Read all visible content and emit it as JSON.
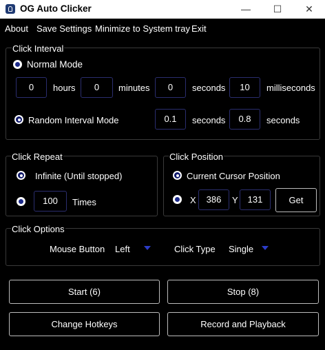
{
  "window": {
    "title": "OG Auto Clicker",
    "minimize": "—",
    "maximize": "☐",
    "close": "✕"
  },
  "menu": [
    "About",
    "Save Settings",
    "Minimize to System tray",
    "Exit"
  ],
  "click_interval": {
    "title": "Click Interval",
    "normal_mode": "Normal Mode",
    "hours_value": "0",
    "hours_label": "hours",
    "minutes_value": "0",
    "minutes_label": "minutes",
    "seconds_value": "0",
    "seconds_label": "seconds",
    "ms_value": "10",
    "ms_label": "milliseconds",
    "random_mode": "Random Interval Mode",
    "random_min": "0.1",
    "random_min_label": "seconds",
    "random_max": "0.8",
    "random_max_label": "seconds"
  },
  "click_repeat": {
    "title": "Click Repeat",
    "infinite": "Infinite (Until stopped)",
    "times_value": "100",
    "times_label": "Times"
  },
  "click_position": {
    "title": "Click Position",
    "current": "Current Cursor Position",
    "x_label": "X",
    "x_value": "386",
    "y_label": "Y",
    "y_value": "131",
    "get_button": "Get"
  },
  "click_options": {
    "title": "Click Options",
    "mouse_button_label": "Mouse Button",
    "mouse_button_value": "Left",
    "click_type_label": "Click Type",
    "click_type_value": "Single"
  },
  "buttons": {
    "start": "Start (6)",
    "stop": "Stop (8)",
    "change_hotkeys": "Change Hotkeys",
    "record_playback": "Record and Playback"
  }
}
